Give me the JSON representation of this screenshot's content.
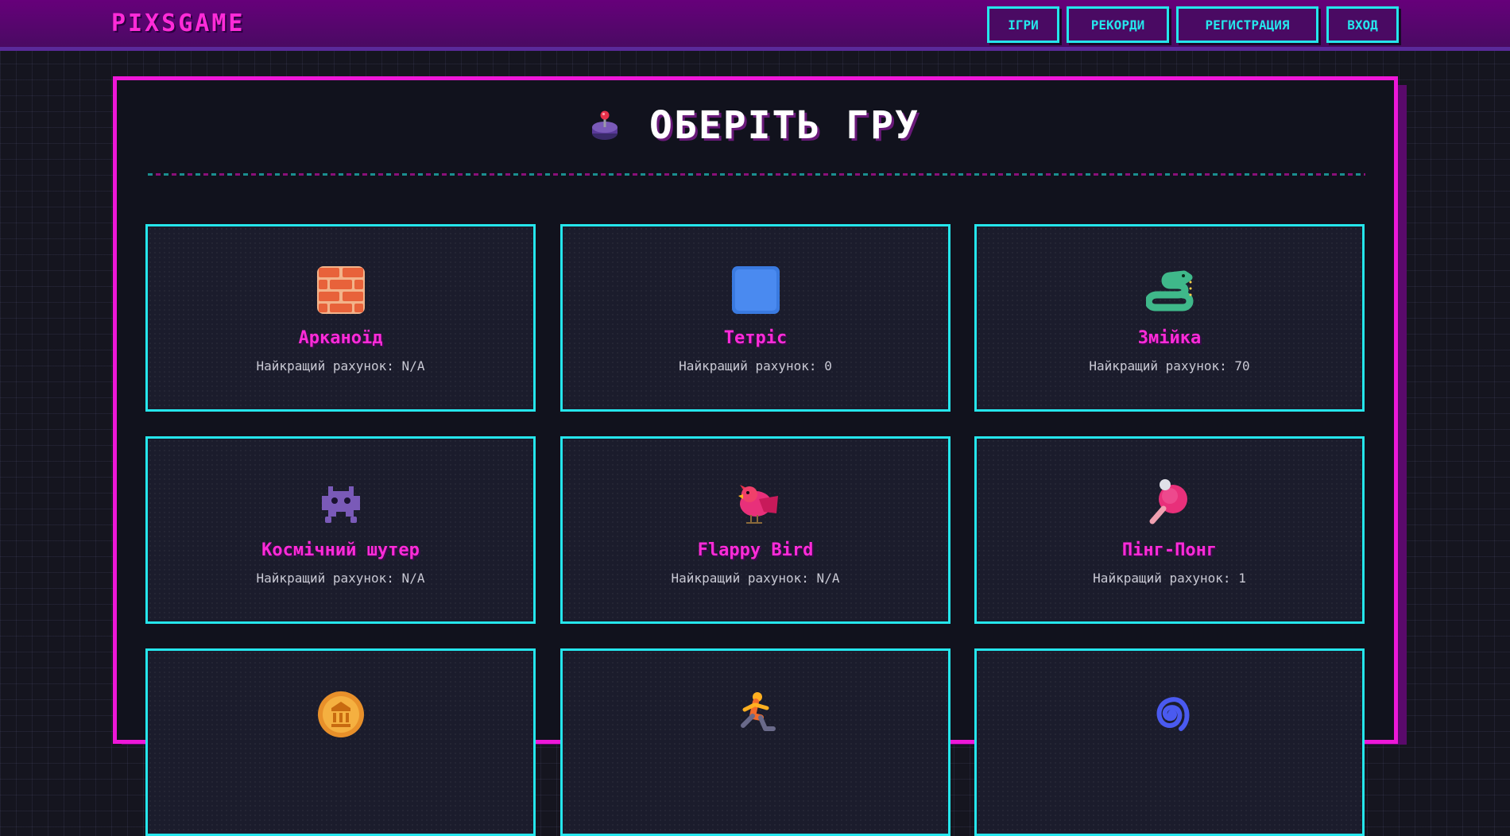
{
  "header": {
    "logo": "PIXSGAME",
    "nav": [
      {
        "label": "ІГРИ"
      },
      {
        "label": "РЕКОРДИ"
      },
      {
        "label": "РЕГИСТРАЦИЯ"
      },
      {
        "label": "ВХОД"
      }
    ]
  },
  "main": {
    "title": "ОБЕРІТЬ ГРУ",
    "title_icon": "joystick-icon",
    "games": [
      {
        "name": "Арканоїд",
        "score_label": "Найкращий рахунок: N/A",
        "icon": "brick-icon"
      },
      {
        "name": "Тетріс",
        "score_label": "Найкращий рахунок: 0",
        "icon": "blue-square-icon"
      },
      {
        "name": "Змійка",
        "score_label": "Найкращий рахунок: 70",
        "icon": "snake-icon"
      },
      {
        "name": "Космічний шутер",
        "score_label": "Найкращий рахунок: N/A",
        "icon": "space-invader-icon"
      },
      {
        "name": "Flappy Bird",
        "score_label": "Найкращий рахунок: N/A",
        "icon": "bird-icon"
      },
      {
        "name": "Пінг-Понг",
        "score_label": "Найкращий рахунок: 1",
        "icon": "ping-pong-icon"
      },
      {
        "name": "",
        "score_label": "",
        "icon": "coin-icon"
      },
      {
        "name": "",
        "score_label": "",
        "icon": "runner-icon"
      },
      {
        "name": "",
        "score_label": "",
        "icon": "spiral-icon"
      }
    ]
  },
  "colors": {
    "accent_magenta": "#ff2bd8",
    "accent_cyan": "#25e6ec",
    "navbar": "#66007a",
    "panel_bg": "#11121d"
  }
}
